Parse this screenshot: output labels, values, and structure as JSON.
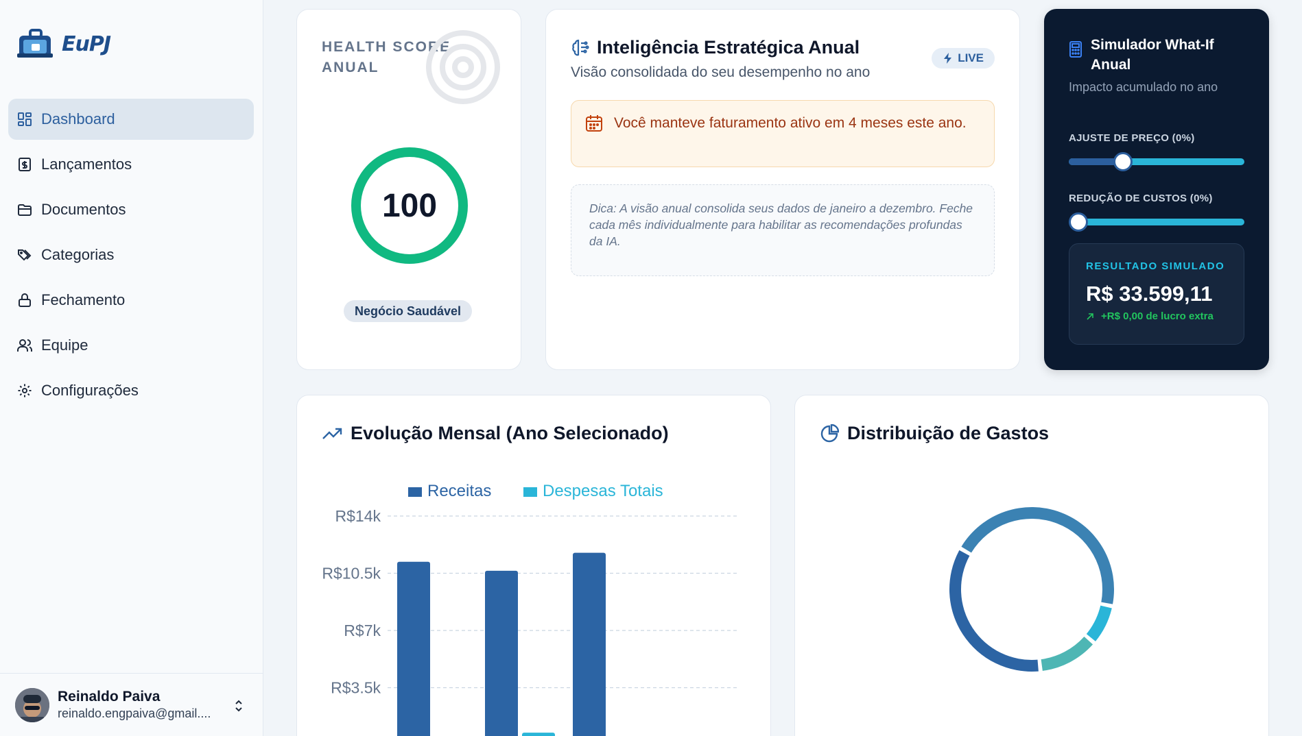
{
  "app": {
    "logo_text": "EuPJ"
  },
  "sidebar": {
    "items": [
      {
        "label": "Dashboard",
        "icon": "dashboard-icon",
        "active": true
      },
      {
        "label": "Lançamentos",
        "icon": "receipt-dollar-icon"
      },
      {
        "label": "Documentos",
        "icon": "folder-icon"
      },
      {
        "label": "Categorias",
        "icon": "tags-icon"
      },
      {
        "label": "Fechamento",
        "icon": "lock-icon"
      },
      {
        "label": "Equipe",
        "icon": "users-icon"
      },
      {
        "label": "Configurações",
        "icon": "gear-icon"
      }
    ]
  },
  "user": {
    "name": "Reinaldo Paiva",
    "email": "reinaldo.engpaiva@gmail...."
  },
  "health": {
    "title": "HEALTH SCORE ANUAL",
    "score": "100",
    "score_fraction": 1.0,
    "badge": "Negócio Saudável",
    "color": "#10b981"
  },
  "intel": {
    "title": "Inteligência Estratégica Anual",
    "subtitle": "Visão consolidada do seu desempenho no ano",
    "badge": "LIVE",
    "alert": "Você manteve faturamento ativo em 4 meses este ano.",
    "tip": "Dica: A visão anual consolida seus dados de janeiro a dezembro. Feche cada mês individualmente para habilitar as recomendações profundas da IA."
  },
  "simulator": {
    "title": "Simulador What-If Anual",
    "subtitle": "Impacto acumulado no ano",
    "price_label": "AJUSTE DE PREÇO (0%)",
    "price_value": 0.31,
    "cost_label": "REDUÇÃO DE CUSTOS (0%)",
    "cost_value": 0.0,
    "result_label": "RESULTADO SIMULADO",
    "result_value": "R$ 33.599,11",
    "result_extra": "+R$ 0,00 de lucro extra"
  },
  "evolution": {
    "title": "Evolução Mensal (Ano Selecionado)"
  },
  "distribution": {
    "title": "Distribuição de Gastos"
  },
  "chart_data": [
    {
      "type": "bar",
      "legend": [
        "Receitas",
        "Despesas Totais"
      ],
      "y_ticks": [
        "R$14k",
        "R$10.5k",
        "R$7k",
        "R$3.5k"
      ],
      "ylim": [
        0,
        14000
      ],
      "grid": true,
      "legend_position": "top",
      "series": [
        {
          "name": "Receitas",
          "color": "#2c64a4",
          "values": [
            11200,
            10650,
            11750
          ]
        },
        {
          "name": "Despesas Totais",
          "color": "#2ab5d8",
          "values": [
            150,
            750,
            null
          ]
        }
      ]
    },
    {
      "type": "pie",
      "donut": true,
      "slices": [
        {
          "value": 45,
          "color": "#3b82b3"
        },
        {
          "value": 8,
          "color": "#2ab5d8"
        },
        {
          "value": 12,
          "color": "#4eb6b4"
        },
        {
          "value": 35,
          "color": "#2c64a4"
        }
      ]
    }
  ]
}
